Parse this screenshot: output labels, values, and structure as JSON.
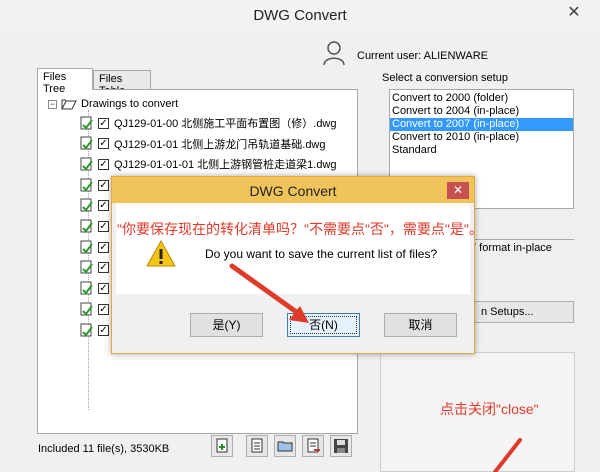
{
  "window": {
    "title": "DWG Convert",
    "close_glyph": "✕"
  },
  "user": {
    "label": "Current user: ALIENWARE"
  },
  "tabs": [
    {
      "label": "Files Tree"
    },
    {
      "label": "Files Table"
    }
  ],
  "tree": {
    "root_label": "Drawings to convert",
    "items": [
      {
        "label": "QJ129-01-00 北侧施工平面布置图（修）.dwg"
      },
      {
        "label": "QJ129-01-01 北侧上游龙门吊轨道基础.dwg"
      },
      {
        "label": "QJ129-01-01-01 北侧上游钢管桩走道梁1.dwg"
      },
      {
        "label": ""
      },
      {
        "label": ""
      },
      {
        "label": ""
      },
      {
        "label": ""
      },
      {
        "label": ""
      },
      {
        "label": ""
      },
      {
        "label": ""
      },
      {
        "label": ""
      }
    ]
  },
  "status": {
    "text": "Included 11 file(s), 3530KB"
  },
  "setup": {
    "label": "Select a conversion setup",
    "items": [
      {
        "label": "Convert to 2000 (folder)",
        "selected": false
      },
      {
        "label": "Convert to 2004 (in-place)",
        "selected": false
      },
      {
        "label": "Convert to 2007 (in-place)",
        "selected": true
      },
      {
        "label": "Convert to 2010 (in-place)",
        "selected": false
      },
      {
        "label": "Standard",
        "selected": false
      }
    ],
    "description_fragment": "7 format in-place",
    "setups_button_fragment": "n Setups..."
  },
  "dialog": {
    "title": "DWG Convert",
    "close_glyph": "✕",
    "message": "Do you want to save the current list of files?",
    "yes_label": "是(Y)",
    "no_label": "否(N)",
    "cancel_label": "取消"
  },
  "annotations": {
    "top": "\"你要保存现在的转化清单吗？\"不需要点\"否\"，需要点\"是\"。",
    "bottom": "点击关闭\"close\""
  },
  "colors": {
    "annotation": "#e03a2a",
    "dialog_titlebar": "#f0c45a",
    "selection": "#3399ff"
  }
}
